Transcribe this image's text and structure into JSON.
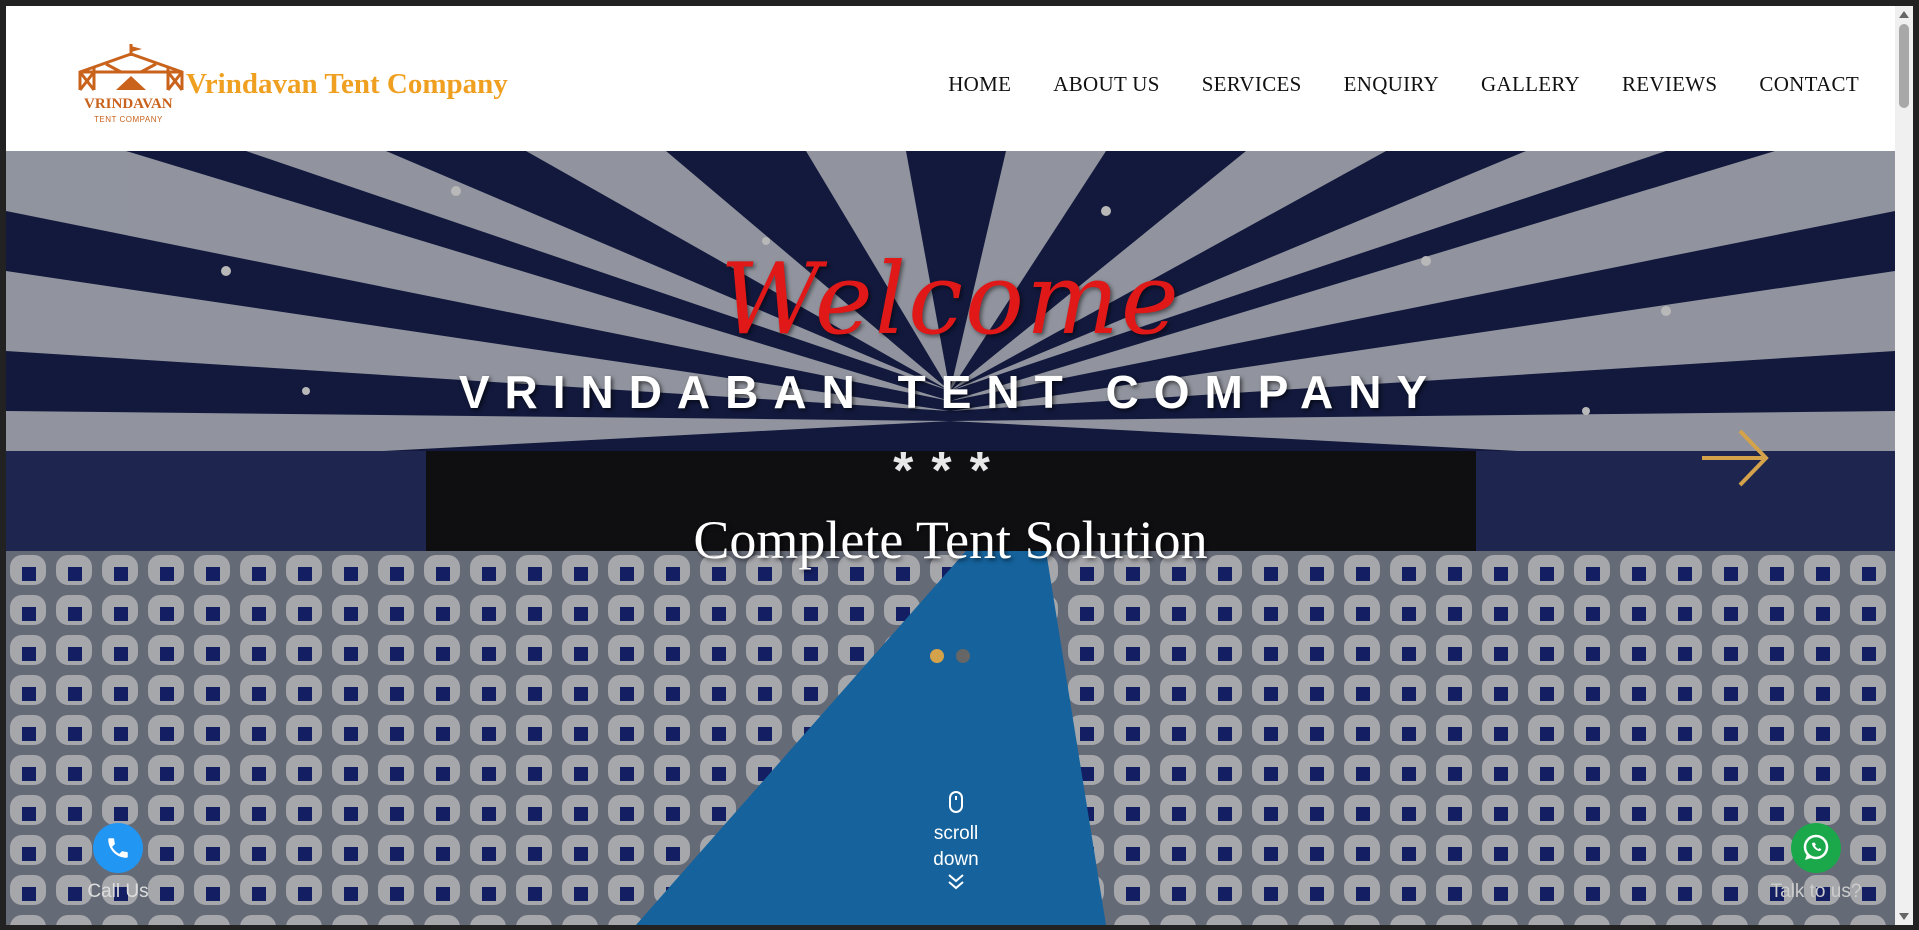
{
  "header": {
    "logo_title": "VRINDAVAN",
    "logo_subtitle": "TENT COMPANY",
    "brand": "Vrindavan Tent Company"
  },
  "nav": {
    "items": [
      {
        "label": "HOME"
      },
      {
        "label": "ABOUT US"
      },
      {
        "label": "SERVICES"
      },
      {
        "label": "ENQUIRY"
      },
      {
        "label": "GALLERY"
      },
      {
        "label": "REVIEWS"
      },
      {
        "label": "CONTACT"
      }
    ]
  },
  "hero": {
    "welcome": "Welcome",
    "company": "VRINDABAN TENT COMPANY",
    "stars": "***",
    "tagline": "Complete Tent Solution",
    "slides_total": 2,
    "active_slide": 1
  },
  "scroll": {
    "line1": "scroll",
    "line2": "down",
    "icon": "mouse-icon"
  },
  "floating": {
    "call_label": "Call Us",
    "whatsapp_label": "Talk to us?"
  },
  "colors": {
    "brand": "#f0a020",
    "welcome": "#e01818",
    "call_button": "#2196f3",
    "whatsapp_button": "#1aa84b",
    "active_dot": "#d4a24a"
  }
}
